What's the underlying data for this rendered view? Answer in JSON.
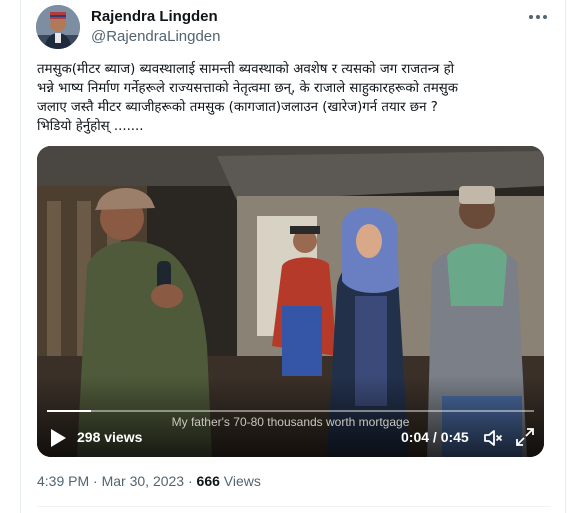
{
  "author": {
    "name": "Rajendra Lingden",
    "handle": "@RajendraLingden"
  },
  "tweet": {
    "text": "तमसुक(मीटर ब्याज) ब्यवस्थालाई सामन्ती ब्यवस्थाको अवशेष र त्यसको जग राजतन्त्र  हो \nभन्ने भाष्य निर्माण गर्नेहरूले राज्यसत्ताको नेतृत्वमा छन्,  के राजाले साहुकारहरूको तमसुक \nजलाए जस्तै मीटर ब्याजीहरूको तमसुक (कागजात)जलाउन (खारेज)गर्न तयार छन ?\nभिडियो हेर्नुहोस् ......."
  },
  "video": {
    "caption": "My father's 70-80 thousands worth mortgage",
    "views": "298 views",
    "time": "0:04 / 0:45",
    "progress": 0.09
  },
  "meta": {
    "time": "4:39 PM",
    "separator": "·",
    "date": "Mar 30, 2023",
    "view_count": "666",
    "views_label": "Views"
  },
  "icons": {
    "more": "more-horizontal-icon",
    "play": "play-icon",
    "volume": "volume-muted-icon",
    "fullscreen": "fullscreen-icon"
  }
}
